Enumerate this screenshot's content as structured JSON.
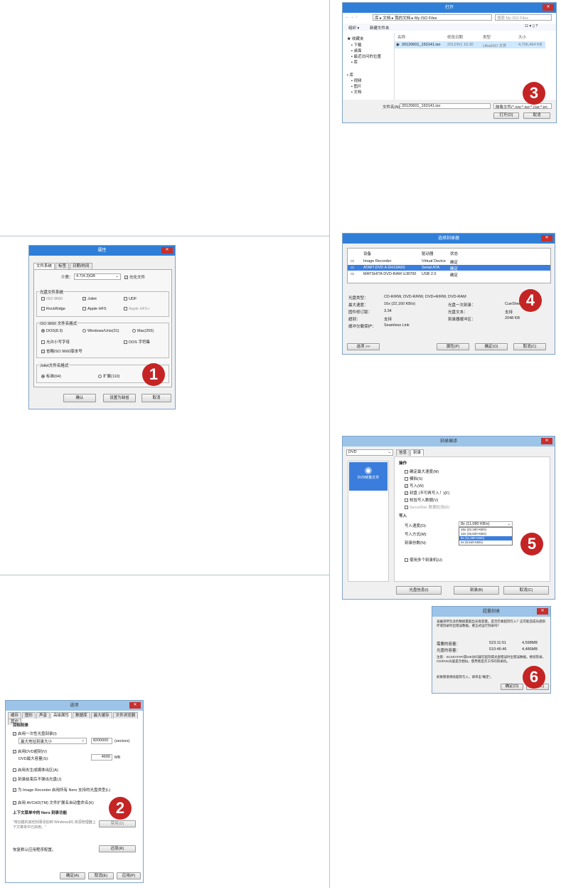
{
  "badges": [
    "1",
    "2",
    "3",
    "4",
    "5",
    "6"
  ],
  "props": {
    "title": "属性",
    "tabs": [
      "文件系统",
      "标签",
      "日期/时间"
    ],
    "media_label": "介质：",
    "media_value": "4.7(4.3)GB",
    "compat_label": "光化文件",
    "fs_group": "光盘文件系统",
    "iso9660": "ISO 9660",
    "joliet": "Joliet",
    "udf": "UDF",
    "rockridge": "RockRidge",
    "applehfs": "Apple HFS",
    "appleplus": "Apple HFS+",
    "fmt_group": "ISO 9660 文件名格式",
    "dos": "DOS(8.3)",
    "win": "Windows/Unix(31)",
    "mac": "Mac(255)",
    "lower": "允许小写字母",
    "doschar": "DOS 字符集",
    "omit": "省略ISO 9660版本号",
    "jol_group": "Joliet文件名格式",
    "std": "标准(64)",
    "ext": "扩展(110)",
    "ok": "确认",
    "default": "设置为缺省",
    "cancel": "取消"
  },
  "options": {
    "title": "选项",
    "tabs": [
      "缓存",
      "图形",
      "声音",
      "高级属性",
      "数据库",
      "最大缓存",
      "文件浏览器",
      "其它"
    ],
    "sec": "目标刻录",
    "c1": "启用一次性光盘刻录(I)",
    "sel": "最大地址刻录大小",
    "num1": "8200000",
    "unit1": "(sectors)",
    "c2": "启用DVD超刻(V)",
    "dvdsize": "DVD最大容量(S):",
    "num2": "4600",
    "unit2": "MB",
    "c3": "启用去生成媒体出区(A)",
    "c4": "刻录结束后不弹出光盘(J)",
    "c5": "为 Image Recorder 启用所有 Nero 支持的光盘类型(L)",
    "c6": "启用 AVCHD(TM) 文件扩展名自动重命名(K)",
    "ctx": "上下文菜单中的 Nero 刻录功能",
    "ctxdesc": "\"将创建的其他刻录添加到 Windows(R) 资源管理器上下文菜单中已启用。\"",
    "disable": "禁用(D)",
    "reset": "恢复默认应用程序配置。",
    "resetbtn": "还原(R)",
    "ok": "确定(A)",
    "cancel": "取消(E)",
    "apply": "应用(P)"
  },
  "open": {
    "title": "打开",
    "path": [
      "库",
      "文档",
      "我的文档",
      "My ISO Files"
    ],
    "search": "搜索 My ISO Files",
    "organize": "组织 ▾",
    "newfolder": "新建文件夹",
    "cols": [
      "名称",
      "修改日期",
      "类型",
      "大小"
    ],
    "file": {
      "name": "20120601_163141.iso",
      "date": "2012/6/1 16:30",
      "type": "UltraISO 文件",
      "size": "4,706,464 KB"
    },
    "nav": [
      "收藏夹",
      "下载",
      "桌面",
      "最近访问的位置",
      "库",
      "库",
      "视频",
      "图片",
      "文档"
    ],
    "fname_label": "文件名(N):",
    "fname": "20120601_163141.iso",
    "filter": "映像文件(*.nrg;*.iso;*.cue;*.im",
    "open": "打开(O)",
    "cancel": "取消"
  },
  "rec": {
    "title": "选择刻录器",
    "cols": [
      "设备",
      "驱动器",
      "状态"
    ],
    "rows": [
      [
        "Image Recorder",
        "Virtual Device",
        "确定"
      ],
      [
        "ATAPI DVD A DH16A6S",
        "Serial ATA",
        "确定"
      ],
      [
        "MATSHITA DVD-RAM UJ8700",
        "USB 2.0",
        "确定"
      ]
    ],
    "info": [
      [
        "光盘类型：",
        "CD-R/RW, DVD-R/RW, DVD+R/RW, DVD-RAM",
        "",
        ""
      ],
      [
        "最大速度：",
        "16x (22,160 KB/s)",
        "光盘一次刻录：",
        "CueSheet"
      ],
      [
        "固件修订版：",
        "3.34",
        "光盘文本：",
        "支持"
      ],
      [
        "超刻：",
        "支持",
        "刻录器缓冲区：",
        "2048 KB"
      ],
      [
        "缓冲欠载保护：",
        "Seamless Link",
        "",
        ""
      ]
    ],
    "options": "选项 >>",
    "prop": "属性(P)",
    "ok": "确定(O)",
    "cancel": "取消(C)"
  },
  "burn": {
    "title": "刻录编译",
    "drive": "DVD",
    "tabs": [
      "信息",
      "刻录"
    ],
    "left": "DVD映像文件",
    "sec_ops": "操作",
    "ops": [
      "确定最大速度(M)",
      "模拟(S)",
      "写入(W)",
      "封盘 (不可再写入！)(F)",
      "校验写入数据(V)",
      "SecurDisc 数据检测(D)"
    ],
    "sec_write": "写入",
    "speed_label": "写入速度(D):",
    "speed_val": "8x (11,080 KB/s)",
    "method_label": "写入方式(M):",
    "copies_label": "刻录份数(N):",
    "speeds": [
      "16x (22,160 KB/s)",
      "12x (16,620 KB/s)",
      "8x (11,080 KB/s)",
      "4x (5,540 KB/s)"
    ],
    "multi": "使用多个刻录机(U)",
    "footer": [
      "光盘信息(I)",
      "刻录(B)",
      "取消(C)"
    ]
  },
  "prog": {
    "title": "超量刻录",
    "msg": "该编译所包含的数据量超出光盘容量。是否仍要超刻写入？这可能造成光盘损坏或刻录时出错误数据。要正式运行刻录吗？",
    "rows": [
      [
        "需要的容量：",
        "523:11:51",
        "4,598MB"
      ],
      [
        "光盘的容量：",
        "510:46:46",
        "4,486MB"
      ]
    ],
    "note": "注意：SCSI/ATAPI或IDE访问器在超刻或光盘错误时出错误数据。继续刻录。CD/DVD光驱是否相似。使用者是否工作的刻录机。",
    "confirm": "如果愿意继续超刻写入，请单击\"确定\"。",
    "ok": "确定(O)",
    "cancel": "取消(C)"
  }
}
